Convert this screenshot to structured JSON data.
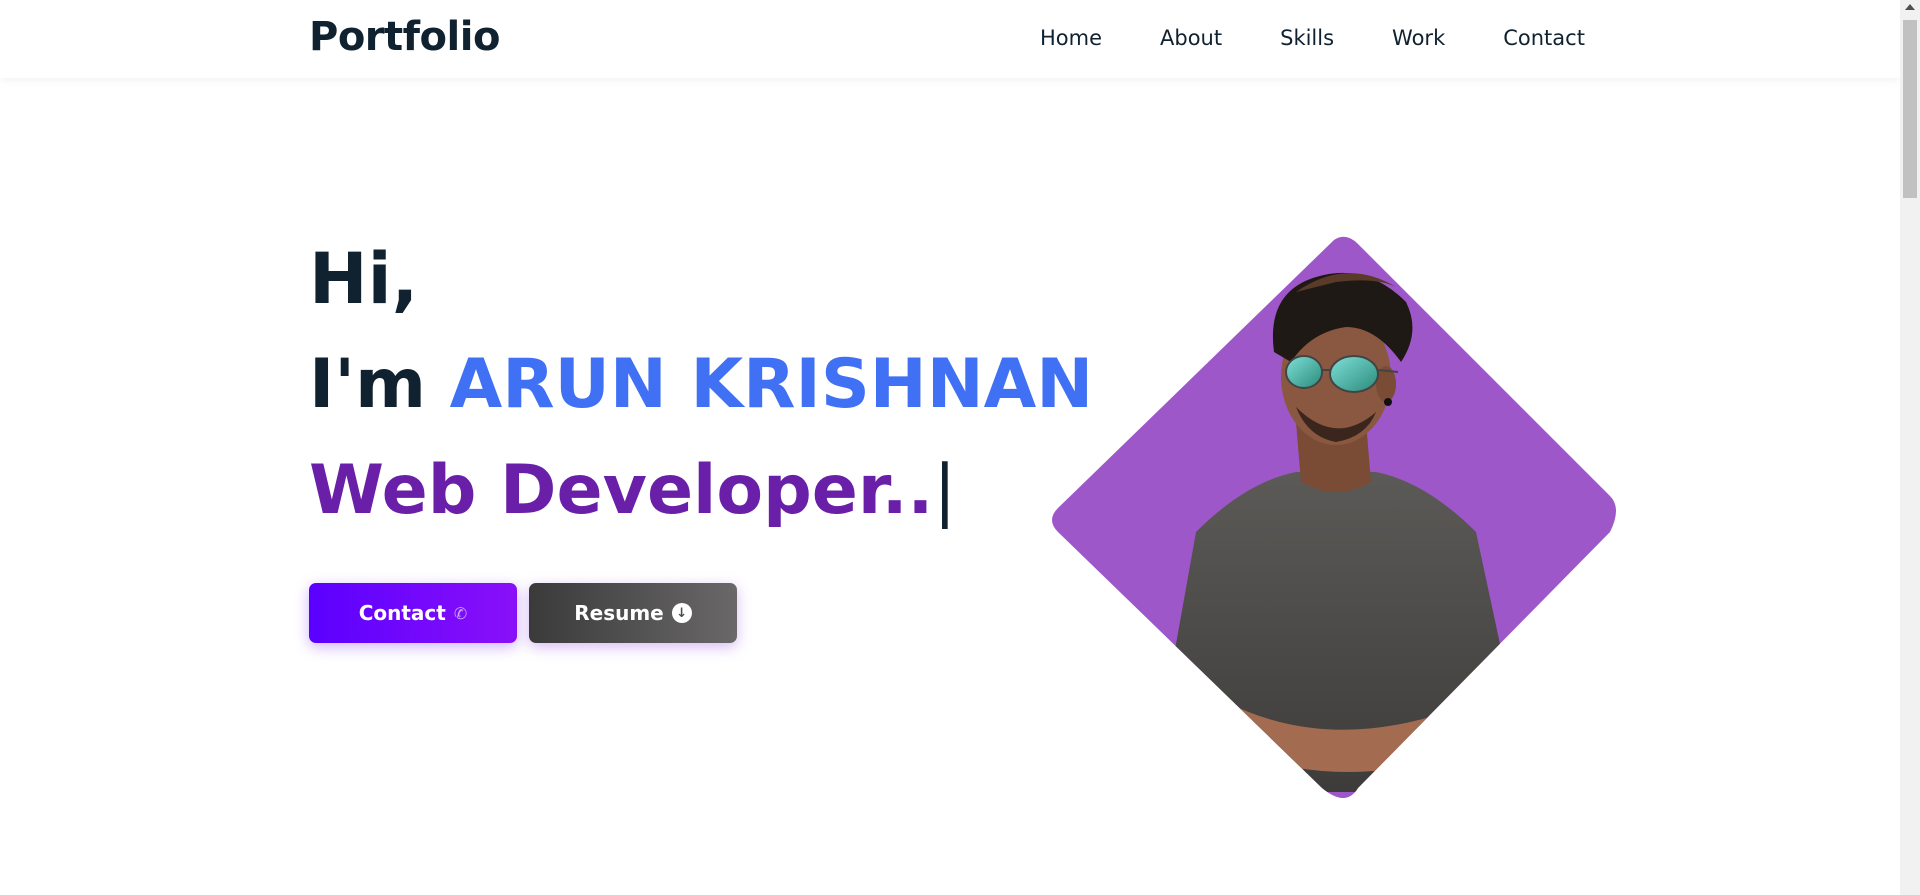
{
  "header": {
    "logo": "Portfolio",
    "nav": [
      "Home",
      "About",
      "Skills",
      "Work",
      "Contact"
    ]
  },
  "hero": {
    "greeting": "Hi,",
    "intro_prefix": "I'm",
    "name": "ARUN KRISHNAN",
    "role": "Web Developer..",
    "cursor": "|"
  },
  "buttons": {
    "contact_label": "Contact",
    "contact_icon": "phone-icon",
    "resume_label": "Resume",
    "resume_icon": "download-circle-icon"
  },
  "colors": {
    "accent_blue": "#4070f4",
    "role_purple": "#6a1fa8",
    "diamond_purple": "#9d57c9",
    "contact_gradient_start": "#5a00ff",
    "contact_gradient_end": "#8a10f8"
  }
}
